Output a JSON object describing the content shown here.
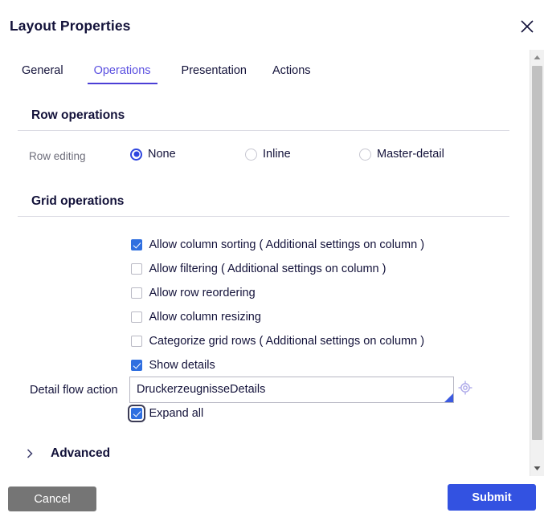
{
  "dialog": {
    "title": "Layout Properties",
    "close_icon": "close-icon"
  },
  "tabs": [
    {
      "label": "General",
      "active": false
    },
    {
      "label": "Operations",
      "active": true
    },
    {
      "label": "Presentation",
      "active": false
    },
    {
      "label": "Actions",
      "active": false
    }
  ],
  "sections": {
    "row_operations": {
      "title": "Row operations",
      "row_editing": {
        "label": "Row editing",
        "options": [
          {
            "label": "None",
            "selected": true
          },
          {
            "label": "Inline",
            "selected": false
          },
          {
            "label": "Master-detail",
            "selected": false
          }
        ]
      }
    },
    "grid_operations": {
      "title": "Grid operations",
      "checkboxes": [
        {
          "label": "Allow column sorting ( Additional settings on column )",
          "checked": true,
          "focused": false
        },
        {
          "label": "Allow filtering ( Additional settings on column )",
          "checked": false,
          "focused": false
        },
        {
          "label": "Allow row reordering",
          "checked": false,
          "focused": false
        },
        {
          "label": "Allow column resizing",
          "checked": false,
          "focused": false
        },
        {
          "label": "Categorize grid rows ( Additional settings on column )",
          "checked": false,
          "focused": false
        },
        {
          "label": "Show details",
          "checked": true,
          "focused": false
        },
        {
          "label": "Expand all",
          "checked": true,
          "focused": true
        }
      ],
      "detail_flow_action": {
        "label": "Detail flow action",
        "value": "DruckerzeugnisseDetails",
        "placeholder": "",
        "picker_icon": "target-icon"
      }
    }
  },
  "advanced": {
    "label": "Advanced",
    "icon": "chevron-right-icon",
    "expanded": false
  },
  "scrollbar": {
    "up_icon": "caret-up-icon",
    "down_icon": "caret-down-icon"
  },
  "footer": {
    "cancel_label": "Cancel",
    "submit_label": "Submit"
  },
  "colors": {
    "accent": "#4B3FD6",
    "tab_active": "#5A4FE0",
    "checkbox_checked": "#2F6FE0",
    "radio_checked": "#2F46DF",
    "submit_bg": "#3352E1",
    "cancel_bg": "#757575",
    "text": "#13123A",
    "muted_text": "#6D6D7A"
  }
}
